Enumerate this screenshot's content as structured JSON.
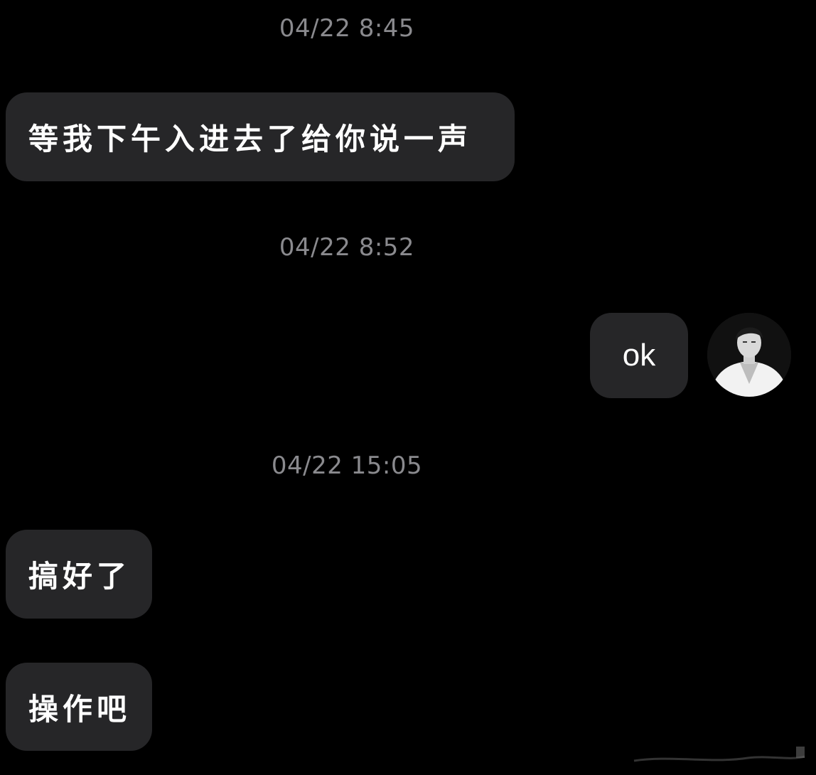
{
  "messages": [
    {
      "type": "timestamp",
      "text": "04/22 8:45"
    },
    {
      "type": "incoming",
      "text": "等我下午入进去了给你说一声"
    },
    {
      "type": "timestamp",
      "text": "04/22 8:52"
    },
    {
      "type": "outgoing",
      "text": "ok"
    },
    {
      "type": "timestamp",
      "text": "04/22 15:05"
    },
    {
      "type": "incoming",
      "text": "搞好了"
    },
    {
      "type": "incoming",
      "text": "操作吧"
    }
  ],
  "colors": {
    "background": "#000000",
    "bubble": "#262628",
    "timestamp": "#8a8a8e",
    "text": "#ffffff"
  },
  "icons": {
    "avatar": "user-avatar-photo"
  }
}
